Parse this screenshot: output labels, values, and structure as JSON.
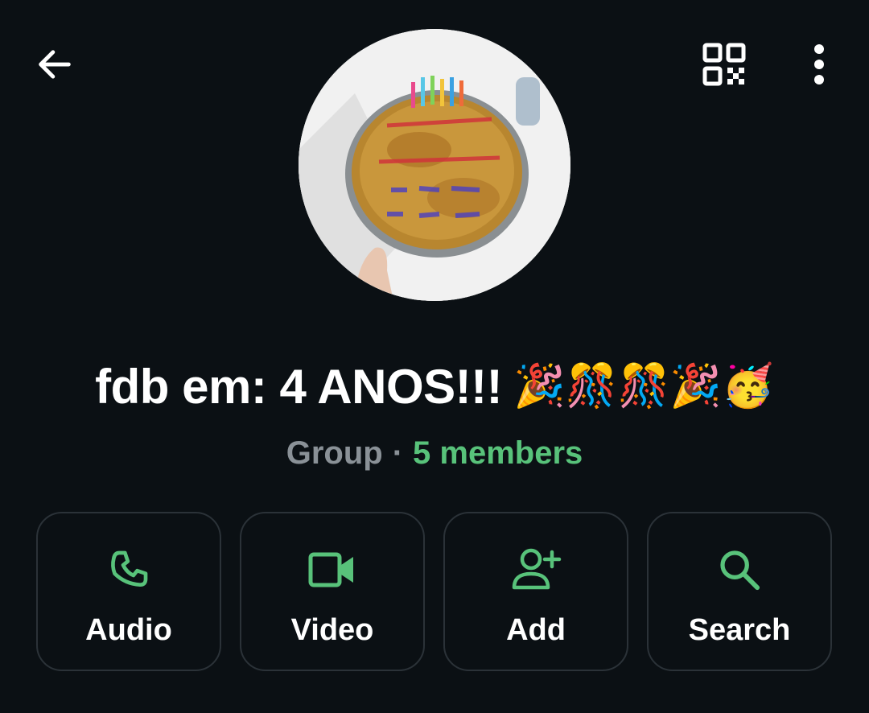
{
  "header": {
    "back_icon": "arrow-left-icon",
    "qr_icon": "qr-code-icon",
    "more_icon": "more-vertical-icon"
  },
  "group": {
    "name": "fdb em: 4 ANOS!!!",
    "name_emojis": "🎉🎊🎊🎉🥳",
    "type": "Group",
    "separator": "·",
    "members": "5 members"
  },
  "actions": [
    {
      "label": "Audio",
      "icon": "phone-icon"
    },
    {
      "label": "Video",
      "icon": "video-camera-icon"
    },
    {
      "label": "Add",
      "icon": "add-person-icon"
    },
    {
      "label": "Search",
      "icon": "search-icon"
    }
  ],
  "colors": {
    "background": "#0b1014",
    "accent": "#58c27a",
    "muted_text": "#8a9197",
    "button_border": "#2b3238"
  }
}
